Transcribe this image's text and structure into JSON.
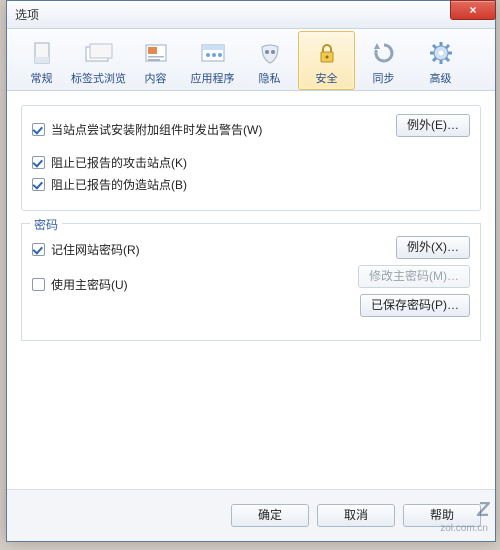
{
  "window": {
    "title": "选项",
    "close_glyph": "×"
  },
  "toolbar": {
    "items": [
      {
        "label": "常规"
      },
      {
        "label": "标签式浏览"
      },
      {
        "label": "内容"
      },
      {
        "label": "应用程序"
      },
      {
        "label": "隐私"
      },
      {
        "label": "安全",
        "selected": true
      },
      {
        "label": "同步"
      },
      {
        "label": "高级"
      }
    ]
  },
  "security_group": {
    "warn_install_addons": {
      "label": "当站点尝试安装附加组件时发出警告(W)",
      "checked": true
    },
    "block_attack_sites": {
      "label": "阻止已报告的攻击站点(K)",
      "checked": true
    },
    "block_forged_sites": {
      "label": "阻止已报告的伪造站点(B)",
      "checked": true
    },
    "exceptions_btn": "例外(E)…"
  },
  "password_group": {
    "legend": "密码",
    "remember_passwords": {
      "label": "记住网站密码(R)",
      "checked": true
    },
    "use_master_password": {
      "label": "使用主密码(U)",
      "checked": false
    },
    "exceptions_btn": "例外(X)…",
    "change_master_btn": "修改主密码(M)…",
    "saved_passwords_btn": "已保存密码(P)…"
  },
  "footer": {
    "ok": "确定",
    "cancel": "取消",
    "help": "帮助"
  },
  "watermark": {
    "main": "Z",
    "sub": "zol.com.cn"
  }
}
